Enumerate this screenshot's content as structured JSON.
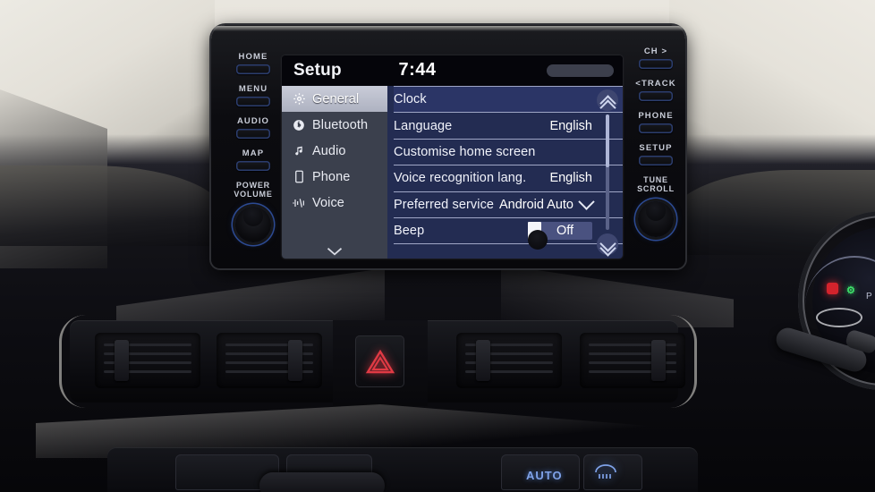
{
  "scene": {
    "vehicle_context": "car-dashboard-centre-console"
  },
  "head_unit": {
    "left_buttons": [
      {
        "label": "HOME",
        "name": "home-button"
      },
      {
        "label": "MENU",
        "name": "menu-button"
      },
      {
        "label": "AUDIO",
        "name": "audio-button"
      },
      {
        "label": "MAP",
        "name": "map-button"
      }
    ],
    "left_knob": {
      "line1": "POWER",
      "line2": "VOLUME"
    },
    "right_buttons": [
      {
        "label": "CH >",
        "name": "channel-up-button"
      },
      {
        "label": "<TRACK",
        "name": "track-back-button"
      },
      {
        "label": "PHONE",
        "name": "phone-button"
      },
      {
        "label": "SETUP",
        "name": "setup-button"
      }
    ],
    "right_knob": {
      "line1": "TUNE",
      "line2": "SCROLL"
    }
  },
  "display": {
    "status_bar": {
      "title": "Setup",
      "clock": "7:44"
    },
    "sidebar": {
      "items": [
        {
          "label": "General",
          "icon": "gear-icon",
          "selected": true
        },
        {
          "label": "Bluetooth",
          "icon": "bluetooth-icon",
          "selected": false
        },
        {
          "label": "Audio",
          "icon": "music-note-icon",
          "selected": false
        },
        {
          "label": "Phone",
          "icon": "phone-icon",
          "selected": false
        },
        {
          "label": "Voice",
          "icon": "voice-wave-icon",
          "selected": false
        }
      ],
      "more_icon": "chevron-down-icon"
    },
    "list": {
      "rows": [
        {
          "label": "Clock",
          "value": "",
          "control": "none",
          "highlighted": true
        },
        {
          "label": "Language",
          "value": "English",
          "control": "none",
          "highlighted": false
        },
        {
          "label": "Customise home screen",
          "value": "",
          "control": "none",
          "highlighted": false
        },
        {
          "label": "Voice recognition lang.",
          "value": "English",
          "control": "none",
          "highlighted": false
        },
        {
          "label": "Preferred service",
          "value": "Android Auto",
          "control": "dropdown",
          "highlighted": false
        },
        {
          "label": "Beep",
          "value": "Off",
          "control": "toggle",
          "highlighted": false
        }
      ]
    },
    "scroll": {
      "up_icon": "double-chevron-up-icon",
      "down_icon": "double-chevron-down-icon"
    }
  },
  "console": {
    "hazard_icon": "hazard-triangle-icon",
    "climate": {
      "auto_label": "AUTO",
      "defrost_icon": "rear-defrost-icon"
    }
  },
  "colors": {
    "screen_panel_blue": "#232c52",
    "row_highlight_blue": "#2b3566",
    "sidebar_slate": "#3b404d",
    "sidebar_selected": "#bcc0cd",
    "button_outline_blue": "#2b3d6e",
    "hazard_red": "#e03a44",
    "climate_blue": "#7fa2e8",
    "cluster_green": "#3ee06a"
  }
}
